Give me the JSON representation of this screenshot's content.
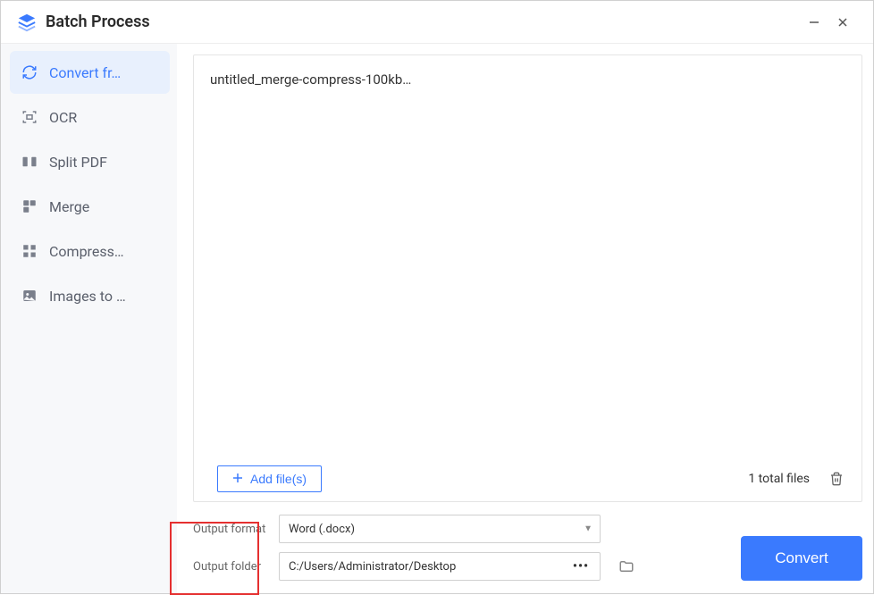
{
  "window": {
    "title": "Batch Process"
  },
  "sidebar": {
    "items": [
      {
        "label": "Convert fr…"
      },
      {
        "label": "OCR"
      },
      {
        "label": "Split PDF"
      },
      {
        "label": "Merge"
      },
      {
        "label": "Compress…"
      },
      {
        "label": "Images to …"
      }
    ]
  },
  "files": {
    "list": [
      {
        "name": "untitled_merge-compress-100kb…"
      }
    ],
    "add_label": "Add file(s)",
    "total_label": "1 total files"
  },
  "settings": {
    "format_label": "Output format",
    "format_value": "Word (.docx)",
    "folder_label": "Output folder",
    "folder_value": "C:/Users/Administrator/Desktop"
  },
  "actions": {
    "convert": "Convert"
  }
}
